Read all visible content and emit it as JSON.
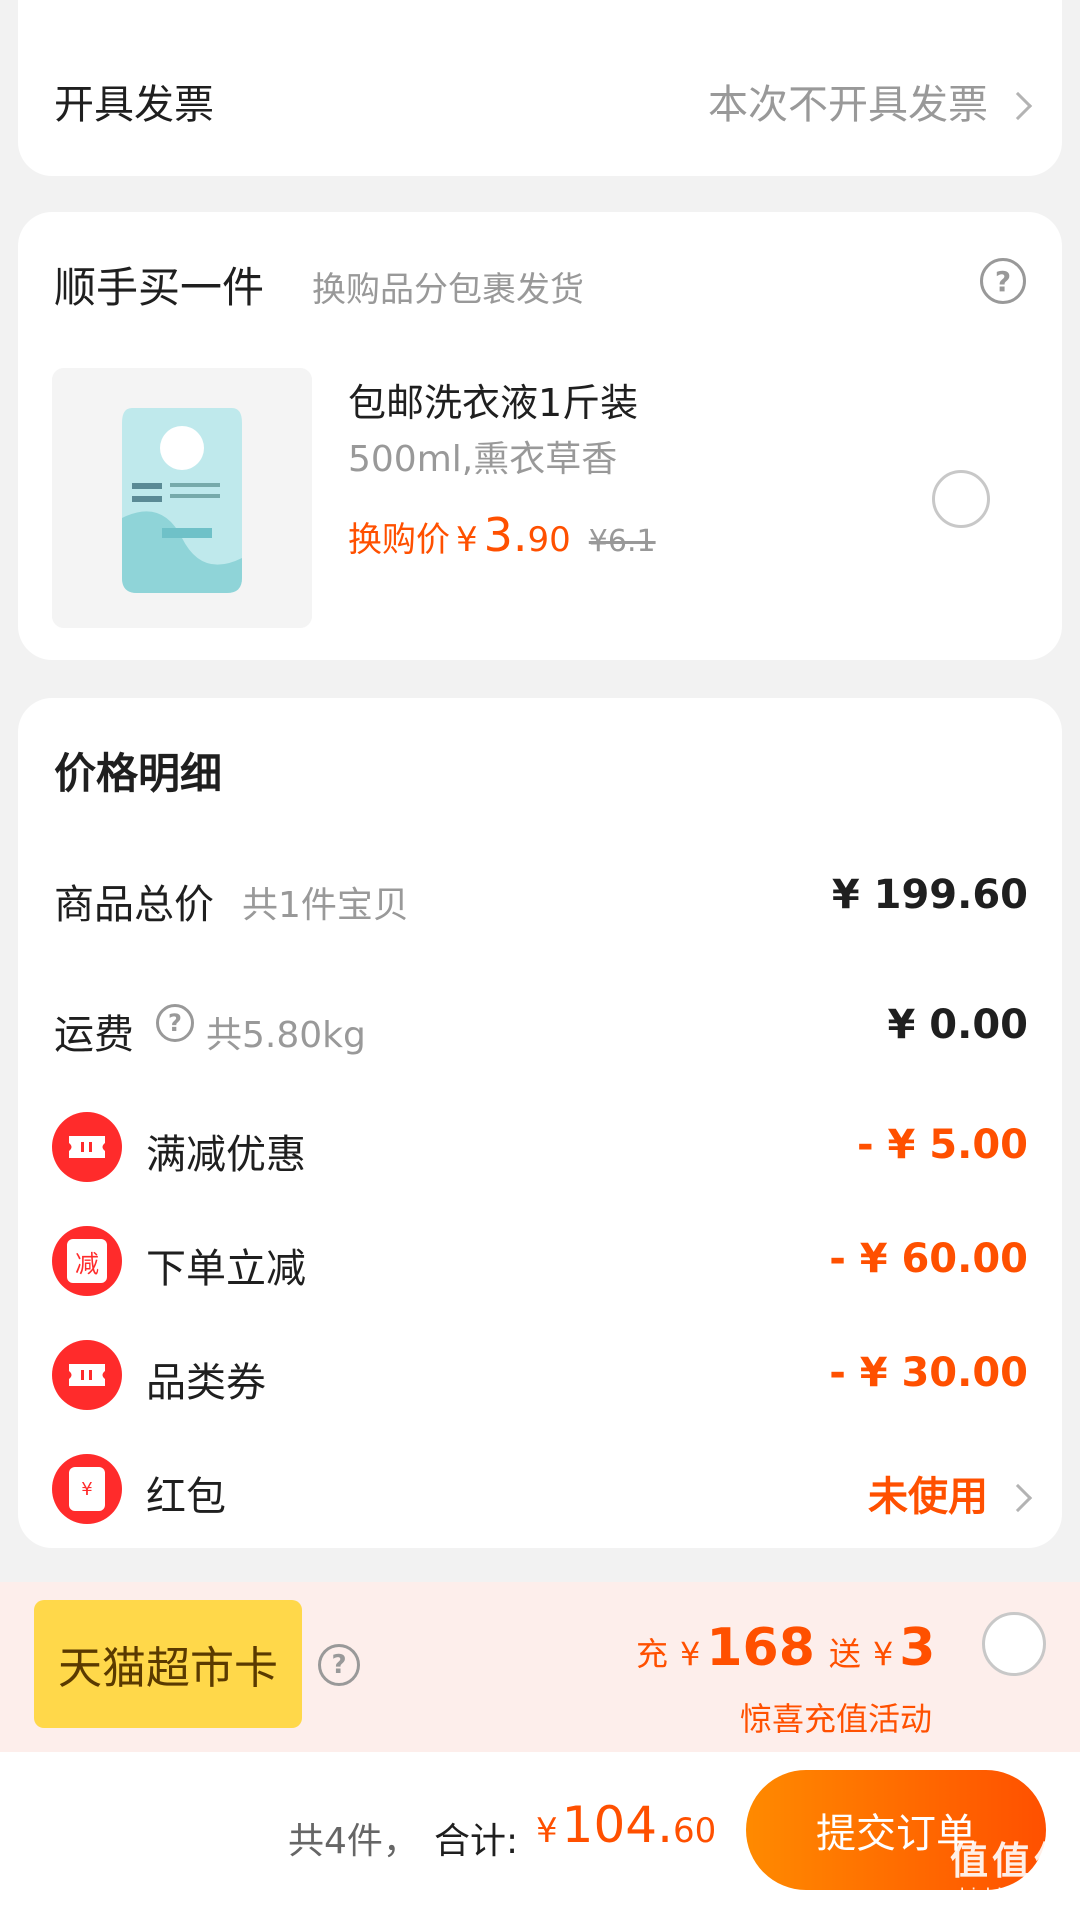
{
  "invoice": {
    "title": "开具发票",
    "value": "本次不开具发票"
  },
  "addon": {
    "title": "顺手买一件",
    "subtitle": "换购品分包裹发货",
    "product": {
      "name": "包邮洗衣液1斤装",
      "spec": "500ml,熏衣草香",
      "price_label": "换购价",
      "currency": "¥",
      "price_int": "3.",
      "price_dec": "90",
      "original_price": "¥6.1",
      "selected": false
    }
  },
  "price_detail": {
    "title": "价格明细",
    "goods_total": {
      "label": "商品总价",
      "sub": "共1件宝贝",
      "amount": "¥ 199.60"
    },
    "shipping": {
      "label": "运费",
      "sub": "共5.80kg",
      "amount": "¥ 0.00"
    },
    "discounts": [
      {
        "label": "满减优惠",
        "amount": "- ¥ 5.00",
        "icon": "ticket-icon"
      },
      {
        "label": "下单立减",
        "amount": "- ¥ 60.00",
        "icon": "reduce-icon",
        "icon_text": "减"
      },
      {
        "label": "品类券",
        "amount": "- ¥ 30.00",
        "icon": "ticket-icon"
      },
      {
        "label": "红包",
        "amount": "未使用",
        "icon": "red-envelope-icon",
        "icon_text": "¥"
      }
    ]
  },
  "promo": {
    "card_name": "天猫超市卡",
    "recharge_prefix": "充",
    "currency": "¥",
    "recharge_amount": "168",
    "bonus_prefix": "送",
    "bonus_amount": "3",
    "note": "惊喜充值活动",
    "selected": false
  },
  "footer": {
    "count": "共4件，",
    "total_label": "合计:",
    "currency": "¥",
    "total_int": "104.",
    "total_dec": "60",
    "submit_label": "提交订单"
  },
  "watermark": {
    "logo": "值",
    "site": "zhizhizhi.com"
  },
  "colors": {
    "accent": "#ff5000",
    "discount_icon": "#ff2b2b",
    "promo_bg": "#fdeeeb",
    "card_badge": "#ffd84a"
  }
}
